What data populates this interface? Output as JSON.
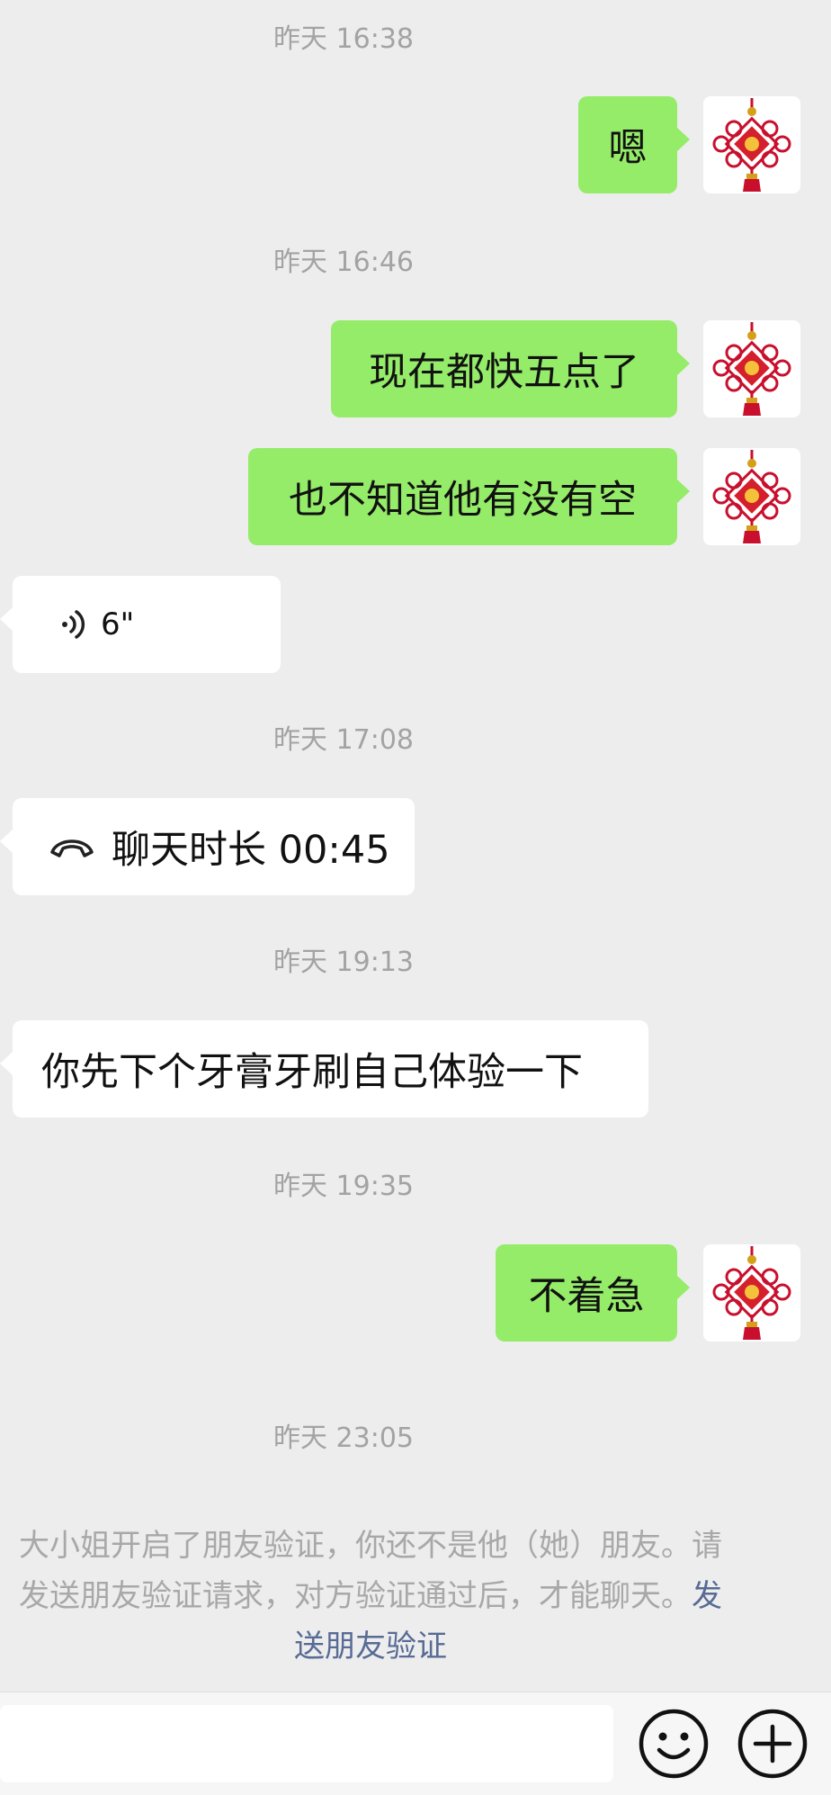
{
  "timestamps": [
    "昨天 16:38",
    "昨天 16:46",
    "昨天 17:08",
    "昨天 19:13",
    "昨天 19:35",
    "昨天 23:05"
  ],
  "messages": {
    "m1": "嗯",
    "m2": "现在都快五点了",
    "m3": "也不知道他有没有空",
    "voice_duration": "6\"",
    "call_text": "聊天时长 00:45",
    "m5": "你先下个牙膏牙刷自己体验一下",
    "m6": "不着急"
  },
  "notice": {
    "line1": "大小姐开启了朋友验证，你还不是他（她）朋友。请",
    "line2": "发送朋友验证请求，对方验证通过后，才能聊天。",
    "link_part1": "发",
    "link_part2": "送朋友验证"
  },
  "icons": {
    "voice": "voice-wave-icon",
    "call": "phone-hangup-icon",
    "emoji": "emoji-icon",
    "plus": "plus-icon",
    "avatar": "chinese-knot-avatar"
  },
  "colors": {
    "background": "#ededed",
    "bubble_green": "#95ec69",
    "bubble_white": "#ffffff",
    "timestamp": "#a3a3a3",
    "link": "#576b95"
  }
}
